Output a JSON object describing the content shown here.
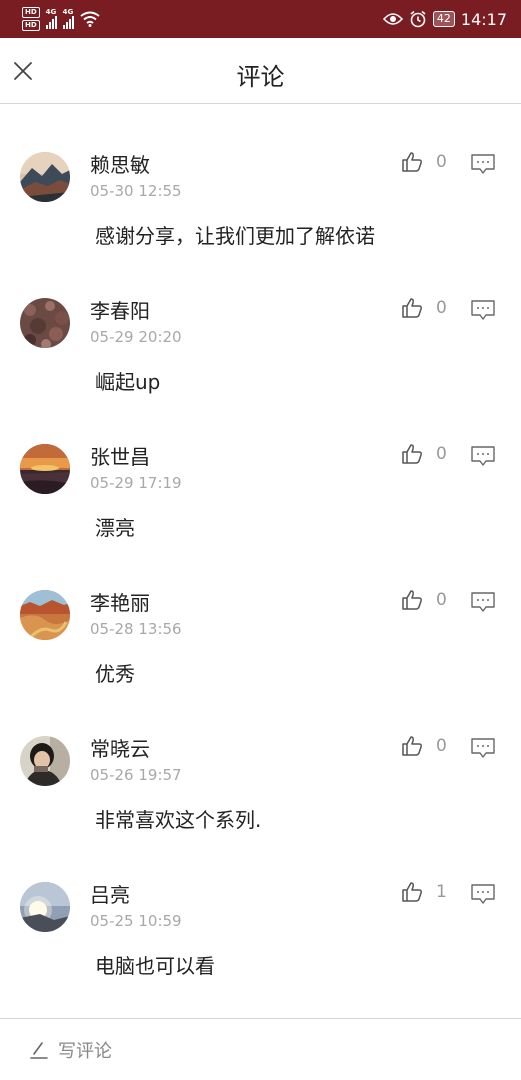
{
  "status_bar": {
    "hd_tags": [
      "HD",
      "HD"
    ],
    "network_labels": [
      "4G",
      "4G"
    ],
    "battery": "42",
    "time": "14:17",
    "colors": {
      "background": "#7a1d22"
    }
  },
  "header": {
    "title": "评论",
    "close_icon": "close-icon"
  },
  "comments": [
    {
      "author": "赖思敏",
      "time": "05-30 12:55",
      "text": "感谢分享，让我们更加了解依诺",
      "likes": "0",
      "avatar": "mountain-sunset"
    },
    {
      "author": "李春阳",
      "time": "05-29 20:20",
      "text": "崛起up",
      "likes": "0",
      "avatar": "rocky-field"
    },
    {
      "author": "张世昌",
      "time": "05-29 17:19",
      "text": "漂亮",
      "likes": "0",
      "avatar": "sunset-sea"
    },
    {
      "author": "李艳丽",
      "time": "05-28 13:56",
      "text": "优秀",
      "likes": "0",
      "avatar": "canyon-river"
    },
    {
      "author": "常晓云",
      "time": "05-26 19:57",
      "text": "非常喜欢这个系列.",
      "likes": "0",
      "avatar": "portrait"
    },
    {
      "author": "吕亮",
      "time": "05-25 10:59",
      "text": "电脑也可以看",
      "likes": "1",
      "avatar": "sunlight-sky"
    }
  ],
  "bottom_bar": {
    "write_label": "写评论",
    "write_icon": "pen-icon"
  },
  "colors": {
    "text_primary": "#222222",
    "text_secondary": "#a8a8a8",
    "divider": "#d8d8d8"
  }
}
